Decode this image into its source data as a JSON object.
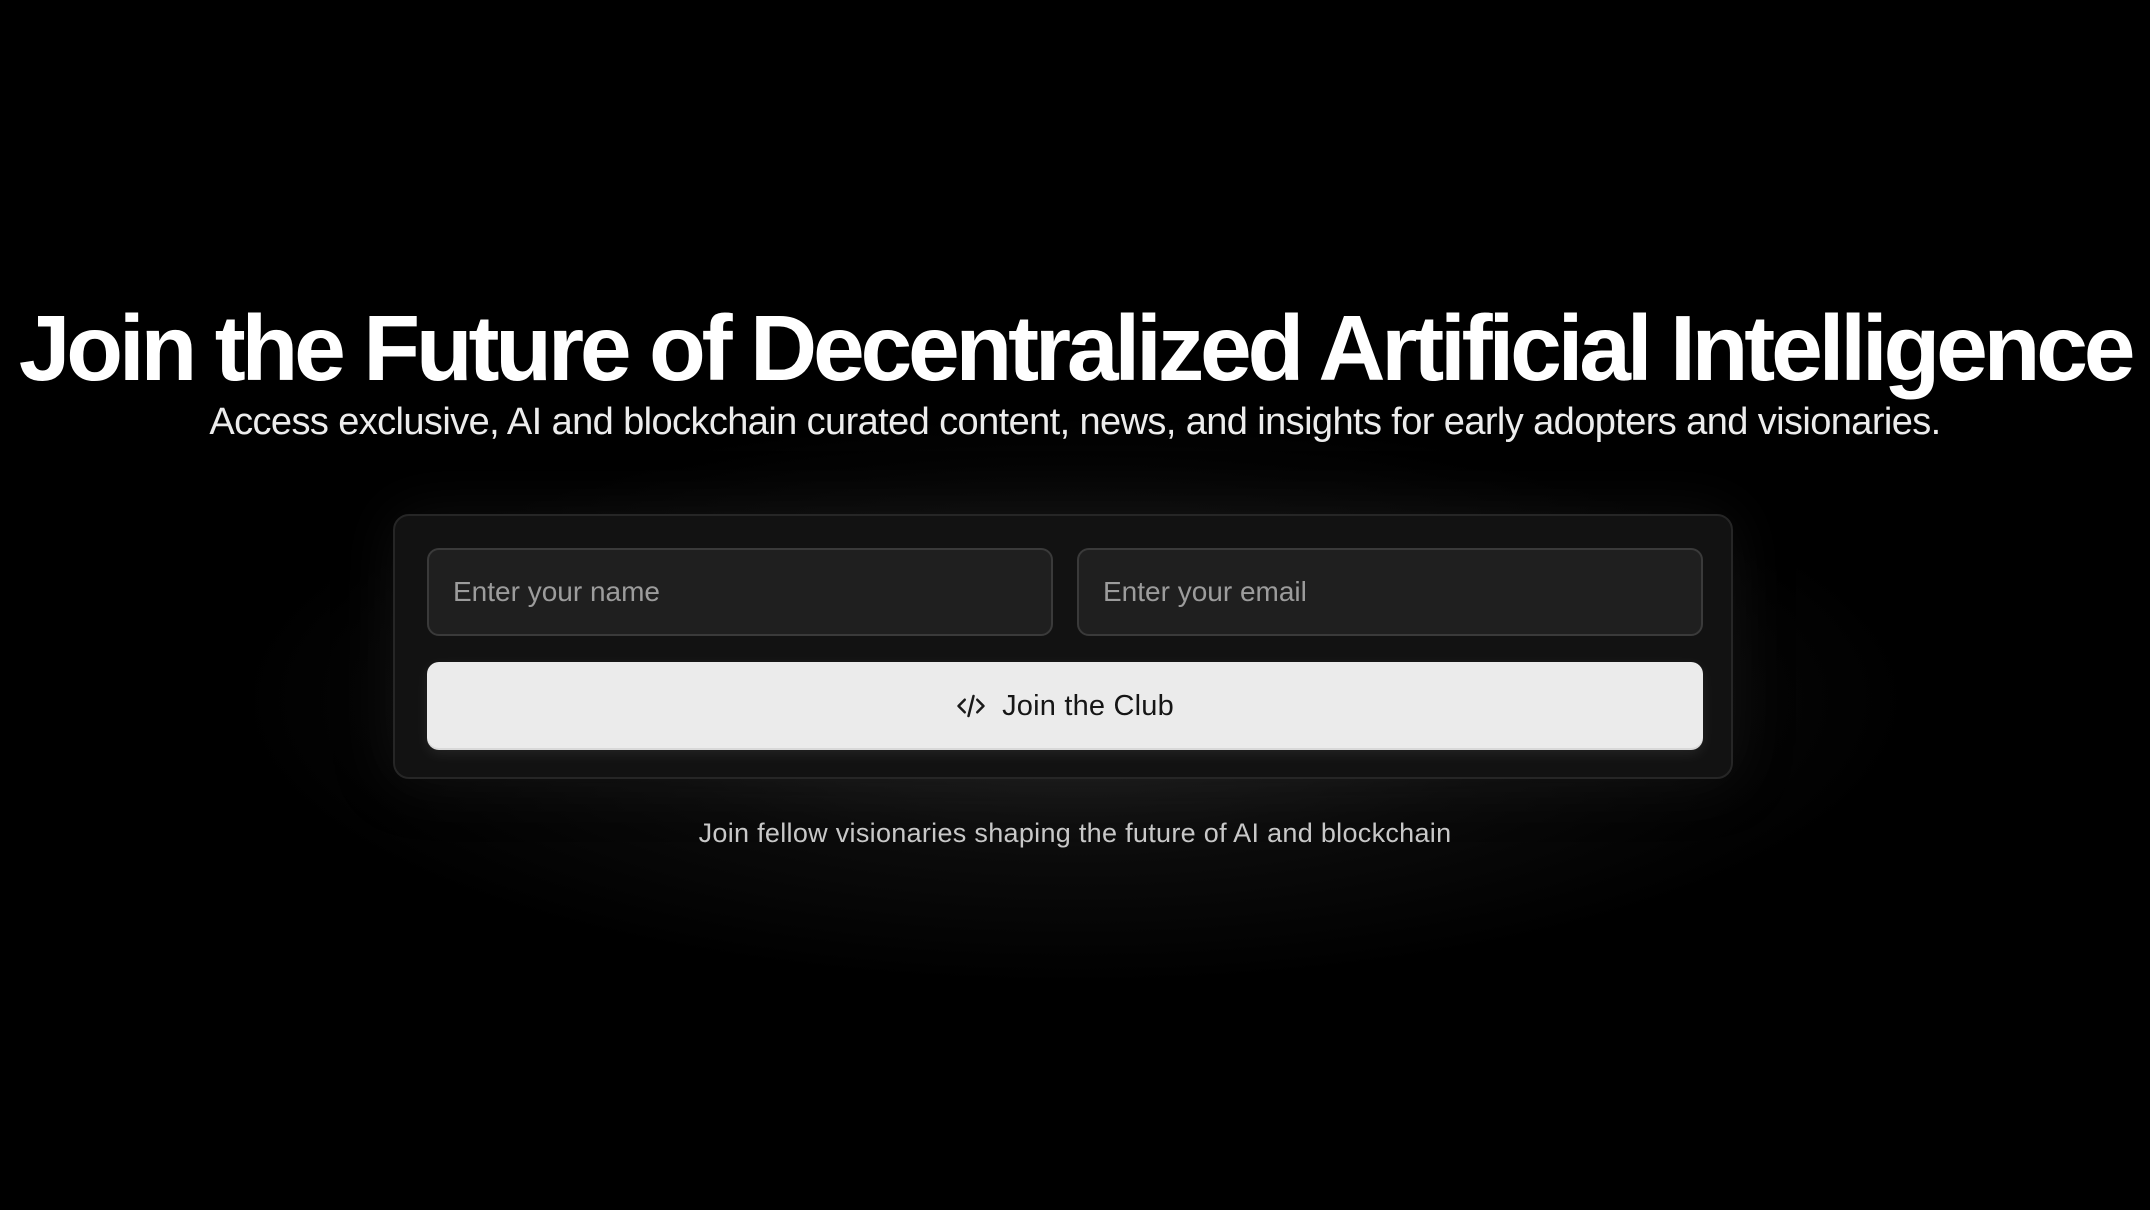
{
  "hero": {
    "title": "Join the Future of Decentralized Artificial Intelligence",
    "subtitle": "Access exclusive, AI and blockchain curated content, news, and insights for early adopters and visionaries."
  },
  "form": {
    "name_placeholder": "Enter your name",
    "name_value": "",
    "email_placeholder": "Enter your email",
    "email_value": "",
    "submit_label": "Join the Club",
    "submit_icon": "code-icon"
  },
  "footnote": "Join fellow visionaries shaping the future of AI and blockchain",
  "colors": {
    "background": "#000000",
    "card": "#121212",
    "input": "#1f1f1f",
    "button": "#ebebeb",
    "text": "#ffffff"
  }
}
